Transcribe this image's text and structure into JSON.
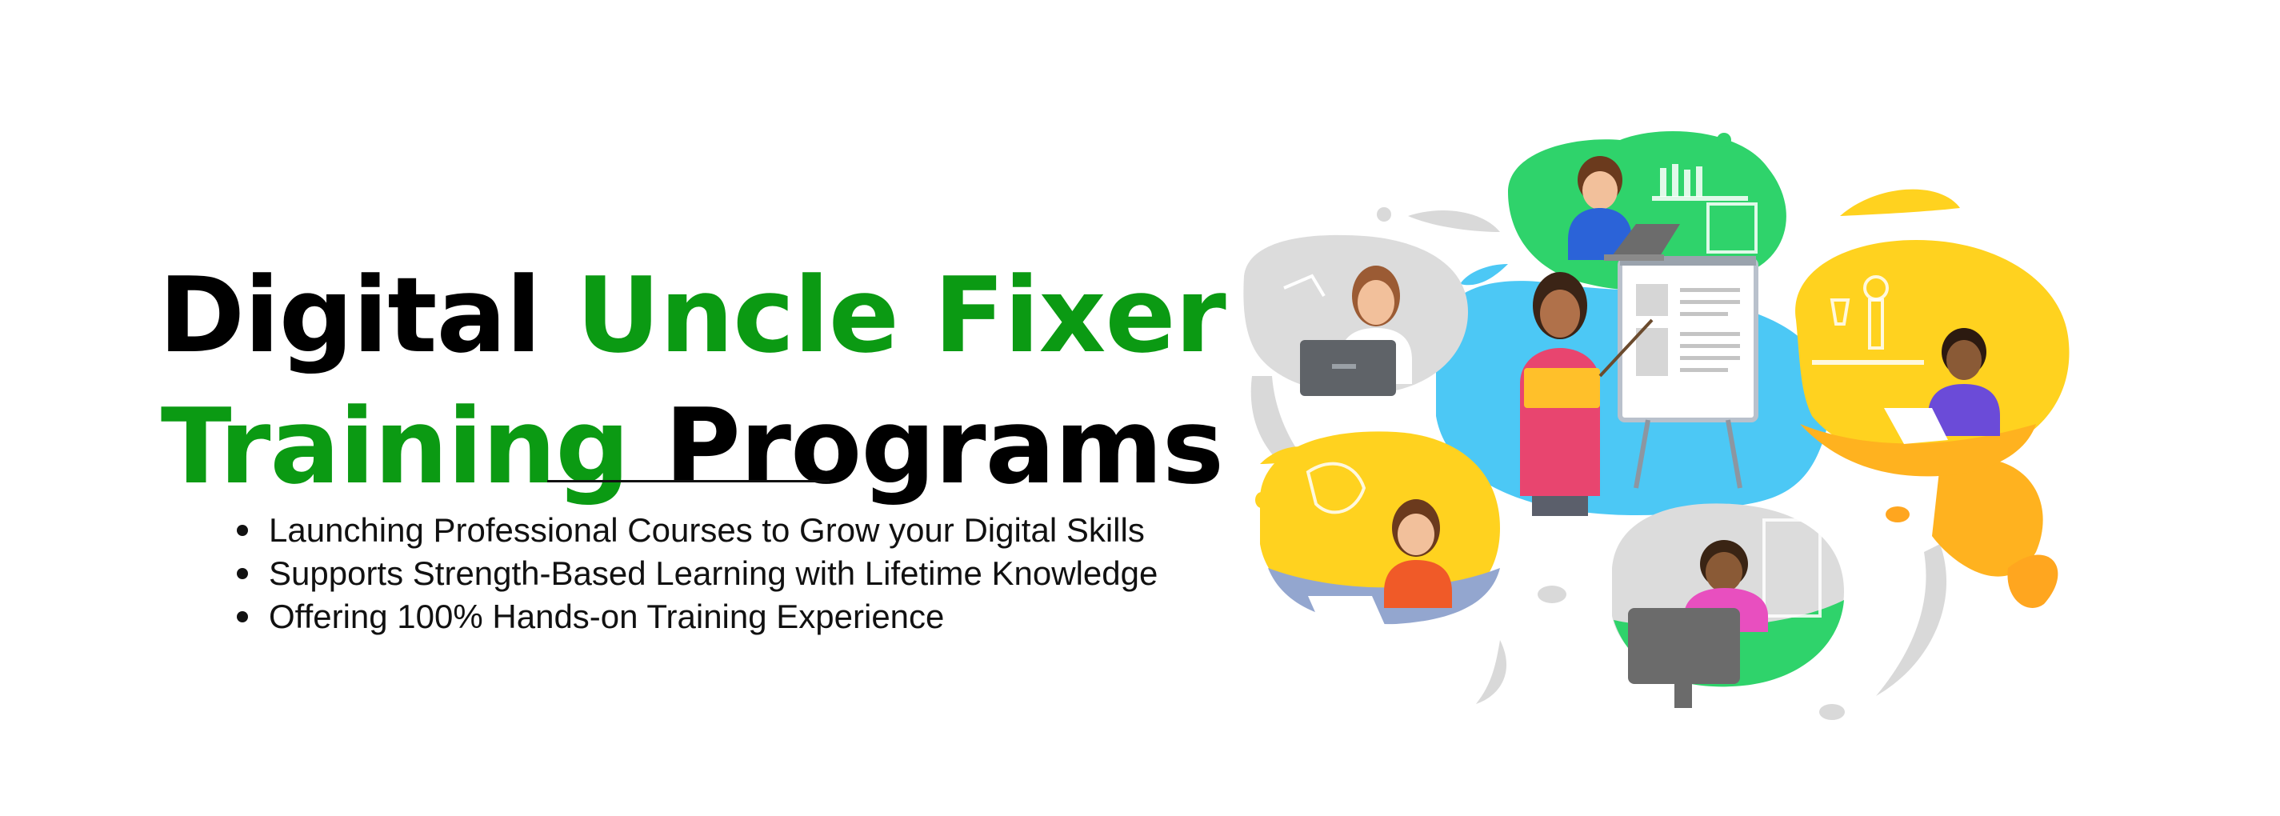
{
  "headline": {
    "line1_dark": "Digital ",
    "line1_accent": "Uncle Fixer",
    "line2_accent": "Training",
    "line2_dark": " Programs"
  },
  "bullets": [
    "Launching Professional Courses to Grow your Digital Skills",
    "Supports Strength-Based Learning with Lifetime Knowledge",
    "Offering 100% Hands-on Training Experience"
  ],
  "colors": {
    "accent_green": "#0b9a13",
    "text_dark": "#000000",
    "blob_blue": "#4cc8f5",
    "blob_green": "#2fd36b",
    "blob_yellow": "#ffd21f",
    "blob_orange": "#ffb21f",
    "blob_grey": "#d6d6d6"
  },
  "illustration": {
    "icon": "online-learning-illustration"
  }
}
